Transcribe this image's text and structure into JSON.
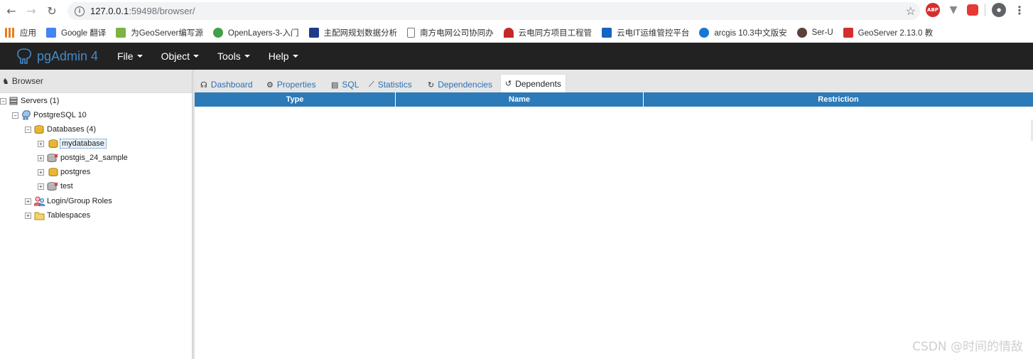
{
  "chrome": {
    "url_host": "127.0.0.1",
    "url_path": ":59498/browser/"
  },
  "bookmarks": [
    {
      "label": "应用",
      "color": "#e67e22"
    },
    {
      "label": "Google 翻译",
      "color": "#4285f4"
    },
    {
      "label": "为GeoServer编写源",
      "color": "#7cb342"
    },
    {
      "label": "OpenLayers-3-入门",
      "color": "#43a047"
    },
    {
      "label": "主配网规划数据分析",
      "color": "#1e3a8a"
    },
    {
      "label": "南方电网公司协同办",
      "color": "#9e9e9e"
    },
    {
      "label": "云电同方项目工程管",
      "color": "#c62828"
    },
    {
      "label": "云电IT运维管控平台",
      "color": "#1565c0"
    },
    {
      "label": "arcgis 10.3中文版安",
      "color": "#1976d2"
    },
    {
      "label": "Ser-U",
      "color": "#5d4037"
    },
    {
      "label": "GeoServer 2.13.0 教",
      "color": "#d32f2f"
    }
  ],
  "app": {
    "brand": "pgAdmin 4",
    "menus": [
      "File",
      "Object",
      "Tools",
      "Help"
    ]
  },
  "browser": {
    "title": "Browser",
    "tree": [
      {
        "label": "Servers (1)",
        "toggle": "-",
        "level": 0,
        "icon": "servers-icon"
      },
      {
        "label": "PostgreSQL 10",
        "toggle": "-",
        "level": 1,
        "icon": "postgres-server-icon"
      },
      {
        "label": "Databases (4)",
        "toggle": "-",
        "level": 2,
        "icon": "databases-icon"
      },
      {
        "label": "mydatabase",
        "toggle": "+",
        "level": 3,
        "icon": "database-icon",
        "selected": true
      },
      {
        "label": "postgis_24_sample",
        "toggle": "+",
        "level": 3,
        "icon": "database-disconnected-icon"
      },
      {
        "label": "postgres",
        "toggle": "+",
        "level": 3,
        "icon": "database-icon"
      },
      {
        "label": "test",
        "toggle": "+",
        "level": 3,
        "icon": "database-disconnected-icon"
      },
      {
        "label": "Login/Group Roles",
        "toggle": "+",
        "level": 2,
        "icon": "roles-icon"
      },
      {
        "label": "Tablespaces",
        "toggle": "+",
        "level": 2,
        "icon": "tablespaces-icon"
      }
    ]
  },
  "tabs": [
    {
      "label": "Dashboard",
      "icon": "dashboard-icon",
      "glyph": "⚙",
      "active": false
    },
    {
      "label": "Properties",
      "icon": "properties-icon",
      "glyph": "⚙",
      "active": false
    },
    {
      "label": "SQL",
      "icon": "sql-icon",
      "glyph": "▤",
      "active": false
    },
    {
      "label": "Statistics",
      "icon": "statistics-icon",
      "glyph": "📈",
      "active": false
    },
    {
      "label": "Dependencies",
      "icon": "dependencies-icon",
      "glyph": "↻",
      "active": false
    },
    {
      "label": "Dependents",
      "icon": "dependents-icon",
      "glyph": "↻",
      "active": true
    }
  ],
  "grid": {
    "columns": [
      "Type",
      "Name",
      "Restriction"
    ]
  },
  "watermark": "CSDN @时间的情敌"
}
